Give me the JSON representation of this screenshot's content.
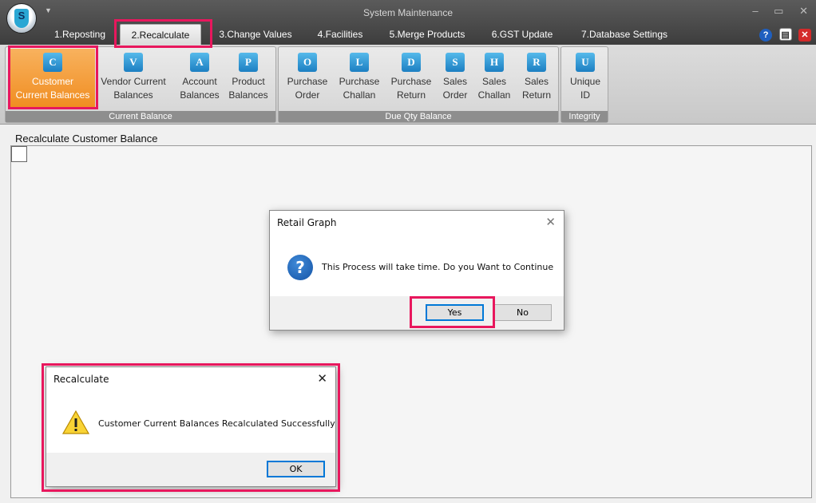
{
  "window": {
    "title": "System Maintenance",
    "controls": [
      "–",
      "▭",
      "✕"
    ]
  },
  "logo": {
    "letter": "S"
  },
  "tabs": [
    {
      "label": "1.Reposting"
    },
    {
      "label": "2.Recalculate"
    },
    {
      "label": "3.Change Values"
    },
    {
      "label": "4.Facilities"
    },
    {
      "label": "5.Merge Products"
    },
    {
      "label": "6.GST Update"
    },
    {
      "label": "7.Database Settings"
    }
  ],
  "ribbon": {
    "groups": [
      {
        "label": "Current Balance",
        "items": [
          {
            "icon": "C",
            "line1": "Customer",
            "line2": "Current Balances"
          },
          {
            "icon": "V",
            "line1": "Vendor Current",
            "line2": "Balances"
          },
          {
            "icon": "A",
            "line1": "Account",
            "line2": "Balances"
          },
          {
            "icon": "P",
            "line1": "Product",
            "line2": "Balances"
          }
        ]
      },
      {
        "label": "Due Qty Balance",
        "items": [
          {
            "icon": "O",
            "line1": "Purchase",
            "line2": "Order"
          },
          {
            "icon": "L",
            "line1": "Purchase",
            "line2": "Challan"
          },
          {
            "icon": "D",
            "line1": "Purchase",
            "line2": "Return"
          },
          {
            "icon": "S",
            "line1": "Sales",
            "line2": "Order"
          },
          {
            "icon": "H",
            "line1": "Sales",
            "line2": "Challan"
          },
          {
            "icon": "R",
            "line1": "Sales",
            "line2": "Return"
          }
        ]
      },
      {
        "label": "Integrity",
        "items": [
          {
            "icon": "U",
            "line1": "Unique",
            "line2": "ID"
          }
        ]
      }
    ]
  },
  "panel": {
    "title": "Recalculate Customer Balance"
  },
  "confirm_dialog": {
    "title": "Retail Graph",
    "message": "This Process will take time. Do you Want to Continue",
    "yes_label": "Yes",
    "no_label": "No",
    "icon": "question-icon"
  },
  "result_dialog": {
    "title": "Recalculate",
    "message": "Customer Current Balances Recalculated Successfully",
    "ok_label": "OK",
    "icon": "warning-icon"
  },
  "colors": {
    "highlight": "#e8175d",
    "selected_ribbon": "#f08c1f",
    "ribbon_icon": "#1c7fc2"
  }
}
